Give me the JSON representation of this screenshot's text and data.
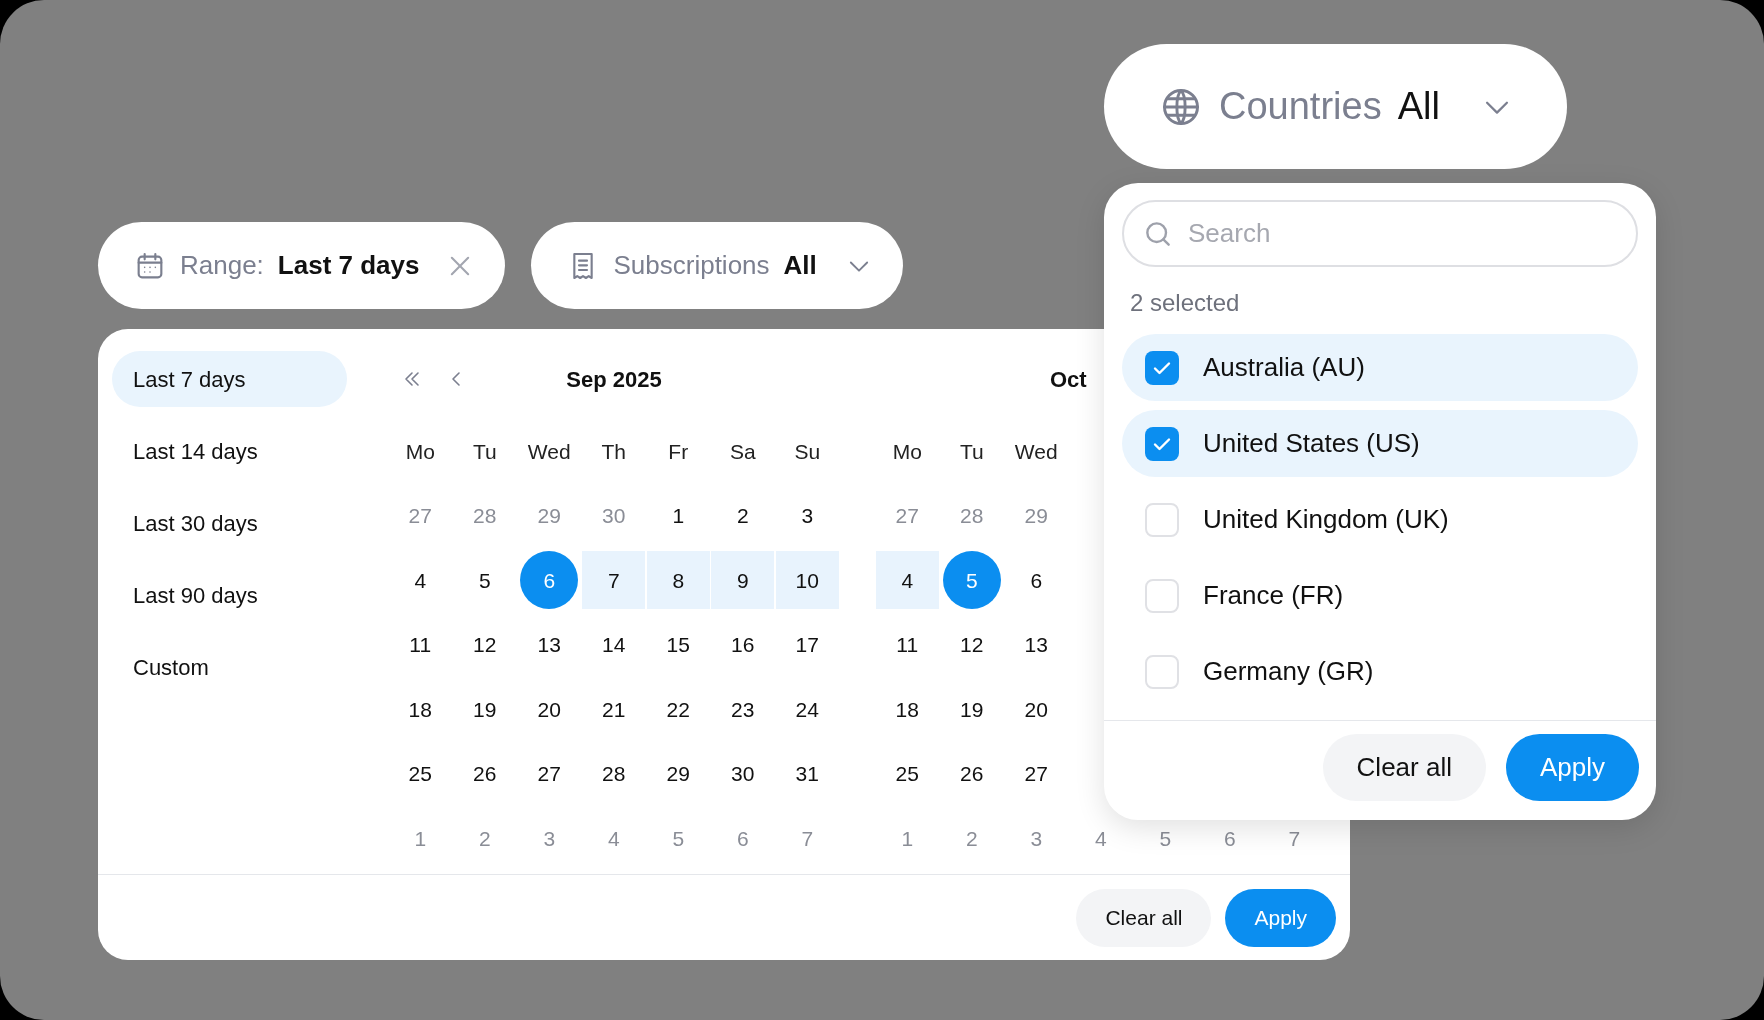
{
  "filters": [
    {
      "kind": "range",
      "label": "Range:",
      "value": "Last 7 days"
    },
    {
      "kind": "dropdown",
      "label": "Subscriptions",
      "value": "All"
    }
  ],
  "date_picker": {
    "presets": [
      {
        "label": "Last 7 days",
        "selected": true
      },
      {
        "label": "Last 14 days",
        "selected": false
      },
      {
        "label": "Last 30 days",
        "selected": false
      },
      {
        "label": "Last 90 days",
        "selected": false
      },
      {
        "label": "Custom",
        "selected": false
      }
    ],
    "months": [
      {
        "title": "Sep 2025",
        "nav": true,
        "weekdays": [
          "Mo",
          "Tu",
          "Wed",
          "Th",
          "Fr",
          "Sa",
          "Su"
        ],
        "weeks": [
          [
            {
              "day": "27",
              "muted": true,
              "selected": false,
              "in_range": false
            },
            {
              "day": "28",
              "muted": true,
              "selected": false,
              "in_range": false
            },
            {
              "day": "29",
              "muted": true,
              "selected": false,
              "in_range": false
            },
            {
              "day": "30",
              "muted": true,
              "selected": false,
              "in_range": false
            },
            {
              "day": "1",
              "muted": false,
              "selected": false,
              "in_range": false
            },
            {
              "day": "2",
              "muted": false,
              "selected": false,
              "in_range": false
            },
            {
              "day": "3",
              "muted": false,
              "selected": false,
              "in_range": false
            }
          ],
          [
            {
              "day": "4",
              "muted": false,
              "selected": false,
              "in_range": false
            },
            {
              "day": "5",
              "muted": false,
              "selected": false,
              "in_range": false
            },
            {
              "day": "6",
              "muted": false,
              "selected": true,
              "in_range": false
            },
            {
              "day": "7",
              "muted": false,
              "selected": false,
              "in_range": true
            },
            {
              "day": "8",
              "muted": false,
              "selected": false,
              "in_range": true
            },
            {
              "day": "9",
              "muted": false,
              "selected": false,
              "in_range": true
            },
            {
              "day": "10",
              "muted": false,
              "selected": false,
              "in_range": true
            }
          ],
          [
            {
              "day": "11",
              "muted": false,
              "selected": false,
              "in_range": false
            },
            {
              "day": "12",
              "muted": false,
              "selected": false,
              "in_range": false
            },
            {
              "day": "13",
              "muted": false,
              "selected": false,
              "in_range": false
            },
            {
              "day": "14",
              "muted": false,
              "selected": false,
              "in_range": false
            },
            {
              "day": "15",
              "muted": false,
              "selected": false,
              "in_range": false
            },
            {
              "day": "16",
              "muted": false,
              "selected": false,
              "in_range": false
            },
            {
              "day": "17",
              "muted": false,
              "selected": false,
              "in_range": false
            }
          ],
          [
            {
              "day": "18",
              "muted": false,
              "selected": false,
              "in_range": false
            },
            {
              "day": "19",
              "muted": false,
              "selected": false,
              "in_range": false
            },
            {
              "day": "20",
              "muted": false,
              "selected": false,
              "in_range": false
            },
            {
              "day": "21",
              "muted": false,
              "selected": false,
              "in_range": false
            },
            {
              "day": "22",
              "muted": false,
              "selected": false,
              "in_range": false
            },
            {
              "day": "23",
              "muted": false,
              "selected": false,
              "in_range": false
            },
            {
              "day": "24",
              "muted": false,
              "selected": false,
              "in_range": false
            }
          ],
          [
            {
              "day": "25",
              "muted": false,
              "selected": false,
              "in_range": false
            },
            {
              "day": "26",
              "muted": false,
              "selected": false,
              "in_range": false
            },
            {
              "day": "27",
              "muted": false,
              "selected": false,
              "in_range": false
            },
            {
              "day": "28",
              "muted": false,
              "selected": false,
              "in_range": false
            },
            {
              "day": "29",
              "muted": false,
              "selected": false,
              "in_range": false
            },
            {
              "day": "30",
              "muted": false,
              "selected": false,
              "in_range": false
            },
            {
              "day": "31",
              "muted": false,
              "selected": false,
              "in_range": false
            }
          ],
          [
            {
              "day": "1",
              "muted": true,
              "selected": false,
              "in_range": false
            },
            {
              "day": "2",
              "muted": true,
              "selected": false,
              "in_range": false
            },
            {
              "day": "3",
              "muted": true,
              "selected": false,
              "in_range": false
            },
            {
              "day": "4",
              "muted": true,
              "selected": false,
              "in_range": false
            },
            {
              "day": "5",
              "muted": true,
              "selected": false,
              "in_range": false
            },
            {
              "day": "6",
              "muted": true,
              "selected": false,
              "in_range": false
            },
            {
              "day": "7",
              "muted": true,
              "selected": false,
              "in_range": false
            }
          ]
        ]
      },
      {
        "title": "Oct",
        "nav": false,
        "weekdays": [
          "Mo",
          "Tu",
          "Wed"
        ],
        "weeks": [
          [
            {
              "day": "27",
              "muted": true,
              "selected": false,
              "in_range": false
            },
            {
              "day": "28",
              "muted": true,
              "selected": false,
              "in_range": false
            },
            {
              "day": "29",
              "muted": true,
              "selected": false,
              "in_range": false
            }
          ],
          [
            {
              "day": "4",
              "muted": false,
              "selected": false,
              "in_range": true
            },
            {
              "day": "5",
              "muted": false,
              "selected": true,
              "in_range": false
            },
            {
              "day": "6",
              "muted": false,
              "selected": false,
              "in_range": false
            }
          ],
          [
            {
              "day": "11",
              "muted": false,
              "selected": false,
              "in_range": false
            },
            {
              "day": "12",
              "muted": false,
              "selected": false,
              "in_range": false
            },
            {
              "day": "13",
              "muted": false,
              "selected": false,
              "in_range": false
            }
          ],
          [
            {
              "day": "18",
              "muted": false,
              "selected": false,
              "in_range": false
            },
            {
              "day": "19",
              "muted": false,
              "selected": false,
              "in_range": false
            },
            {
              "day": "20",
              "muted": false,
              "selected": false,
              "in_range": false
            }
          ],
          [
            {
              "day": "25",
              "muted": false,
              "selected": false,
              "in_range": false
            },
            {
              "day": "26",
              "muted": false,
              "selected": false,
              "in_range": false
            },
            {
              "day": "27",
              "muted": false,
              "selected": false,
              "in_range": false
            }
          ],
          [
            {
              "day": "1",
              "muted": true,
              "selected": false,
              "in_range": false
            },
            {
              "day": "2",
              "muted": true,
              "selected": false,
              "in_range": false
            },
            {
              "day": "3",
              "muted": true,
              "selected": false,
              "in_range": false
            },
            {
              "day": "4",
              "muted": true,
              "selected": false,
              "in_range": false
            },
            {
              "day": "5",
              "muted": true,
              "selected": false,
              "in_range": false
            },
            {
              "day": "6",
              "muted": true,
              "selected": false,
              "in_range": false
            },
            {
              "day": "7",
              "muted": true,
              "selected": false,
              "in_range": false
            }
          ]
        ]
      }
    ],
    "buttons": [
      {
        "label": "Clear all",
        "kind": "secondary"
      },
      {
        "label": "Apply",
        "kind": "primary"
      }
    ]
  },
  "countries": {
    "label": "Countries",
    "value": "All",
    "search": {
      "placeholder": "Search"
    },
    "summary": "2 selected",
    "options": [
      {
        "label": "Australia (AU)",
        "checked": true
      },
      {
        "label": "United States (US)",
        "checked": true
      },
      {
        "label": "United Kingdom (UK)",
        "checked": false
      },
      {
        "label": "France (FR)",
        "checked": false
      },
      {
        "label": "Germany (GR)",
        "checked": false
      }
    ],
    "buttons": [
      {
        "label": "Clear all",
        "kind": "secondary"
      },
      {
        "label": "Apply",
        "kind": "primary"
      }
    ]
  }
}
